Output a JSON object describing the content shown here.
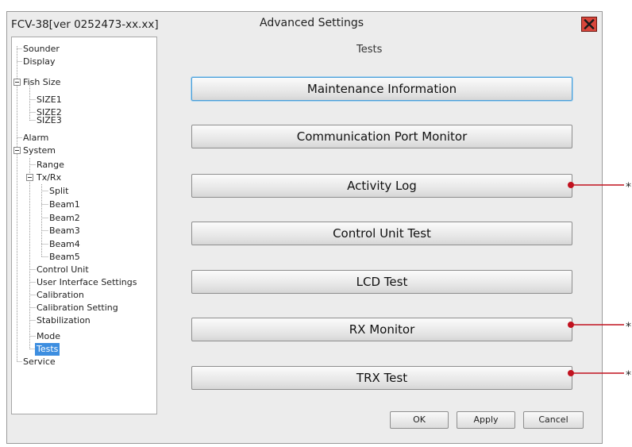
{
  "window": {
    "app_title": "FCV-38[ver 0252473-xx.xx]",
    "dialog_title": "Advanced Settings",
    "section_title": "Tests",
    "close_icon": "close-icon",
    "close_color": "#d9463b"
  },
  "tree": {
    "items": [
      {
        "label": "Sounder",
        "level": 0
      },
      {
        "label": "Display",
        "level": 0
      },
      {
        "label": "Fish Size",
        "level": 0,
        "expanded": true
      },
      {
        "label": "SIZE1",
        "level": 1
      },
      {
        "label": "SIZE2",
        "level": 1
      },
      {
        "label": "SIZE3",
        "level": 1
      },
      {
        "label": "Alarm",
        "level": 0
      },
      {
        "label": "System",
        "level": 0,
        "expanded": true
      },
      {
        "label": "Range",
        "level": 1
      },
      {
        "label": "Tx/Rx",
        "level": 1,
        "expanded": true
      },
      {
        "label": "Split",
        "level": 2
      },
      {
        "label": "Beam1",
        "level": 2
      },
      {
        "label": "Beam2",
        "level": 2
      },
      {
        "label": "Beam3",
        "level": 2
      },
      {
        "label": "Beam4",
        "level": 2
      },
      {
        "label": "Beam5",
        "level": 2
      },
      {
        "label": "Control Unit",
        "level": 1
      },
      {
        "label": "User Interface Settings",
        "level": 1
      },
      {
        "label": "Calibration",
        "level": 1
      },
      {
        "label": "Calibration Setting",
        "level": 1
      },
      {
        "label": "Stabilization",
        "level": 1
      },
      {
        "label": "Mode",
        "level": 1
      },
      {
        "label": "Tests",
        "level": 1,
        "selected": true
      },
      {
        "label": "Service",
        "level": 0
      }
    ],
    "selected_color": "#3d8ee0"
  },
  "buttons": {
    "maintenance": "Maintenance Information",
    "comm_port": "Communication Port Monitor",
    "activity_log": "Activity Log",
    "control_unit_test": "Control Unit Test",
    "lcd_test": "LCD Test",
    "rx_monitor": "RX Monitor",
    "trx_test": "TRX Test"
  },
  "footer": {
    "ok": "OK",
    "apply": "Apply",
    "cancel": "Cancel"
  },
  "callouts": {
    "color": "#c1121f",
    "mark": "*"
  }
}
